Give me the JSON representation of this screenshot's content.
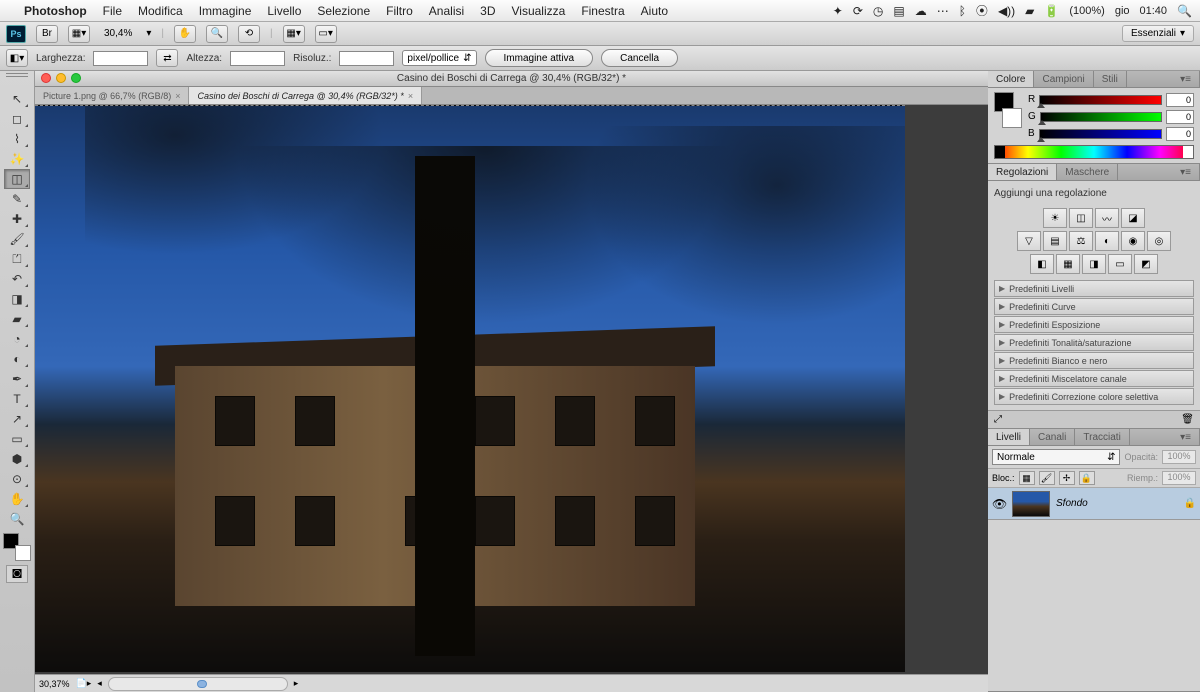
{
  "menubar": {
    "app": "Photoshop",
    "items": [
      "File",
      "Modifica",
      "Immagine",
      "Livello",
      "Selezione",
      "Filtro",
      "Analisi",
      "3D",
      "Visualizza",
      "Finestra",
      "Aiuto"
    ],
    "battery": "(100%)",
    "day": "gio",
    "time": "01:40"
  },
  "optbar": {
    "zoom": "30,4%",
    "workspace": "Essenziali"
  },
  "optbar2": {
    "larghezza_label": "Larghezza:",
    "altezza_label": "Altezza:",
    "risoluz_label": "Risoluz.:",
    "unita": "pixel/pollice",
    "immagine_attiva": "Immagine attiva",
    "cancella": "Cancella"
  },
  "doc": {
    "title": "Casino dei Boschi di Carrega @ 30,4% (RGB/32*) *",
    "tab1": "Picture 1.png @ 66,7% (RGB/8)",
    "tab2": "Casino dei Boschi di Carrega @ 30,4% (RGB/32*) *",
    "status_zoom": "30,37%"
  },
  "colore": {
    "tabs": [
      "Colore",
      "Campioni",
      "Stili"
    ],
    "r_label": "R",
    "g_label": "G",
    "b_label": "B",
    "r_val": "0",
    "g_val": "0",
    "b_val": "0"
  },
  "regolazioni": {
    "tabs": [
      "Regolazioni",
      "Maschere"
    ],
    "label": "Aggiungi una regolazione",
    "presets": [
      "Predefiniti Livelli",
      "Predefiniti Curve",
      "Predefiniti Esposizione",
      "Predefiniti Tonalità/saturazione",
      "Predefiniti Bianco e nero",
      "Predefiniti Miscelatore canale",
      "Predefiniti Correzione colore selettiva"
    ]
  },
  "livelli": {
    "tabs": [
      "Livelli",
      "Canali",
      "Tracciati"
    ],
    "blend": "Normale",
    "opacita_label": "Opacità:",
    "opacita_val": "100%",
    "bloc_label": "Bloc.:",
    "riemp_label": "Riemp.:",
    "riemp_val": "100%",
    "layer_name": "Sfondo"
  }
}
